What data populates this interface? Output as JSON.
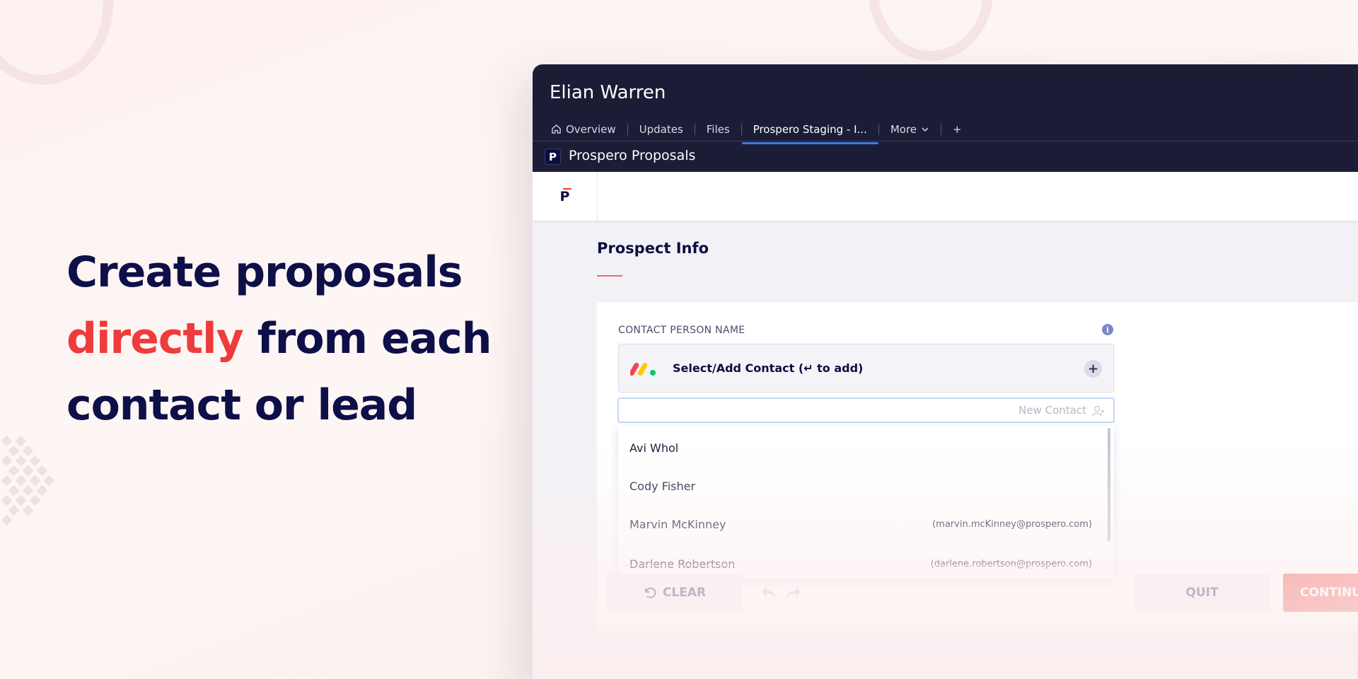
{
  "hero": {
    "line1": "Create proposals",
    "accent": "directly",
    "line2_rest": " from each",
    "line3": "contact or lead"
  },
  "board": {
    "title": "Elian Warren",
    "tabs": [
      {
        "label": "Overview",
        "icon": "home-icon"
      },
      {
        "label": "Updates"
      },
      {
        "label": "Files"
      },
      {
        "label": "Prospero Staging - I..."
      },
      {
        "label": "More",
        "icon": "chevron-down-icon"
      }
    ],
    "add_tab": "+",
    "app_logo": "P",
    "app_name": "Prospero Proposals"
  },
  "subbar": {
    "logo": "P"
  },
  "form": {
    "section_title": "Prospect Info",
    "field_label": "CONTACT PERSON NAME",
    "info": "i",
    "select_placeholder": "Select/Add Contact (↵ to add)",
    "plus": "+",
    "search_placeholder": "New Contact",
    "contacts": [
      {
        "name": "Avi Whol",
        "email": ""
      },
      {
        "name": "Cody Fisher",
        "email": ""
      },
      {
        "name": "Marvin McKinney",
        "email": "(marvin.mcKinney@prospero.com)"
      },
      {
        "name": "Darlene Robertson",
        "email": "(darlene.robertson@prospero.com)"
      }
    ]
  },
  "footer": {
    "clear": "CLEAR",
    "quit": "QUIT",
    "continue": "CONTINUE"
  },
  "colors": {
    "navy": "#0e0f48",
    "accent_red": "#ee3b3b",
    "topbar": "#1b1d36",
    "active_tab": "#3f7be6"
  }
}
